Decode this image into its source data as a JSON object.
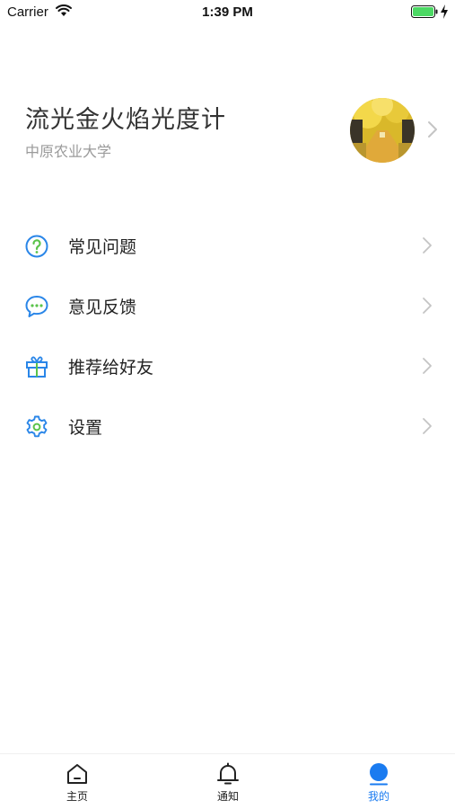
{
  "status_bar": {
    "carrier": "Carrier",
    "time": "1:39 PM"
  },
  "profile": {
    "name": "流光金火焰光度计",
    "school": "中原农业大学"
  },
  "menu": [
    {
      "label": "常见问题",
      "icon": "question-circle-icon"
    },
    {
      "label": "意见反馈",
      "icon": "chat-bubbles-icon"
    },
    {
      "label": "推荐给好友",
      "icon": "gift-icon"
    },
    {
      "label": "设置",
      "icon": "gear-icon"
    }
  ],
  "tabs": [
    {
      "label": "主页",
      "icon": "home-icon",
      "active": false
    },
    {
      "label": "通知",
      "icon": "bell-icon",
      "active": false
    },
    {
      "label": "我的",
      "icon": "profile-icon",
      "active": true
    }
  ],
  "colors": {
    "accent": "#1a7bf0",
    "icon_blue": "#2a86e8",
    "text_secondary": "#9a9a9a",
    "chevron": "#c4c4c4",
    "battery": "#4cd964"
  }
}
